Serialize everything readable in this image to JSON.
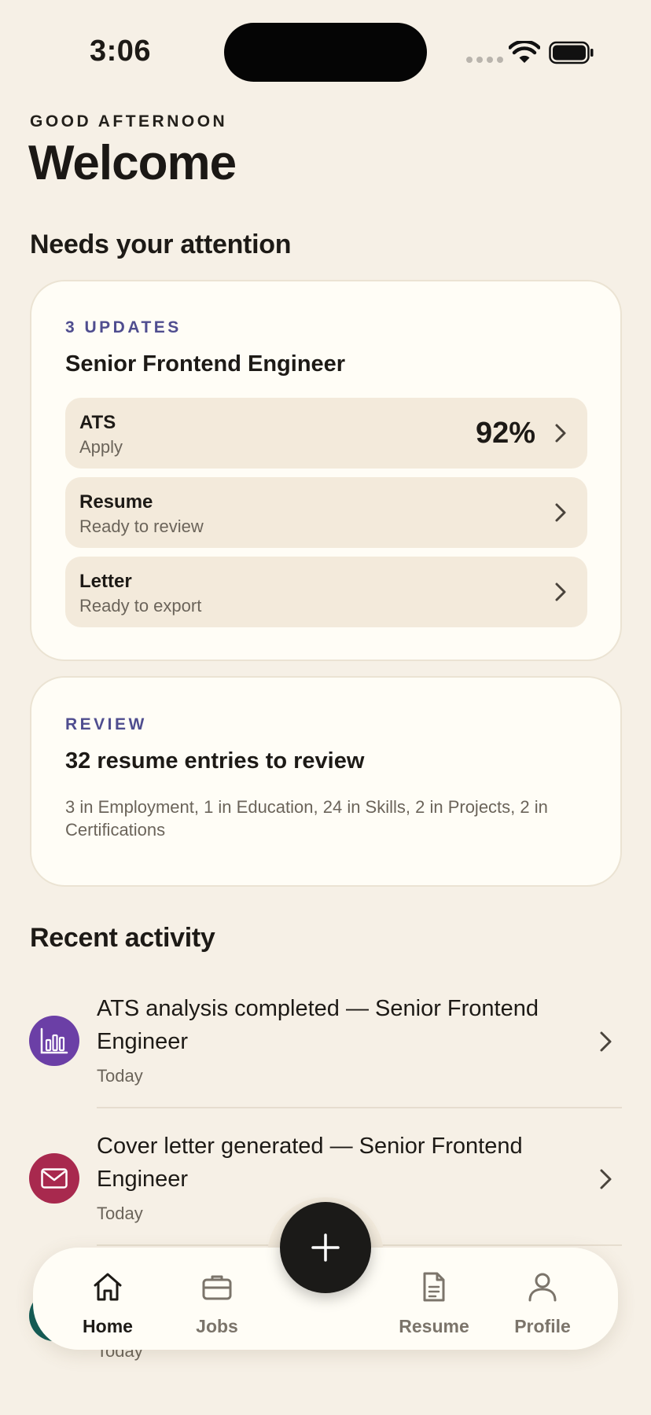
{
  "status_bar": {
    "time": "3:06"
  },
  "header": {
    "greeting": "GOOD AFTERNOON",
    "title": "Welcome"
  },
  "attention": {
    "section_title": "Needs your attention",
    "updates_card": {
      "kicker": "3 UPDATES",
      "title": "Senior Frontend Engineer",
      "rows": [
        {
          "title": "ATS",
          "subtitle": "Apply",
          "value": "92%"
        },
        {
          "title": "Resume",
          "subtitle": "Ready to review"
        },
        {
          "title": "Letter",
          "subtitle": "Ready to export"
        }
      ]
    },
    "review_card": {
      "kicker": "REVIEW",
      "title": "32 resume entries to review",
      "description": "3 in Employment, 1 in Education, 24 in Skills, 2 in Projects, 2 in Certifications"
    }
  },
  "activity": {
    "section_title": "Recent activity",
    "items": [
      {
        "title": "ATS analysis completed — Senior Frontend Engineer",
        "time": "Today",
        "icon": "bar-chart-icon",
        "color": "#6b3fa6"
      },
      {
        "title": "Cover letter generated — Senior Frontend Engineer",
        "time": "Today",
        "icon": "envelope-icon",
        "color": "#a8294e"
      },
      {
        "title": "",
        "time": "Today",
        "icon": "document-icon",
        "color": "#0e5a55"
      }
    ]
  },
  "tab_bar": {
    "tabs": [
      {
        "label": "Home",
        "icon": "home-icon",
        "active": true
      },
      {
        "label": "Jobs",
        "icon": "briefcase-icon",
        "active": false
      },
      {
        "label": "Resume",
        "icon": "document-icon",
        "active": false
      },
      {
        "label": "Profile",
        "icon": "person-icon",
        "active": false
      }
    ],
    "fab_icon": "plus-icon"
  },
  "colors": {
    "background": "#f6f0e6",
    "card": "#fffdf6",
    "row": "#f3eadb",
    "accent": "#4f4d8f",
    "text_primary": "#1d1a16",
    "text_secondary": "#6b645a"
  }
}
